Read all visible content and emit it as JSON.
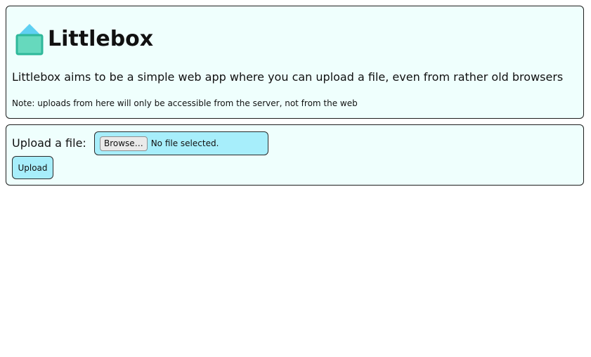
{
  "header": {
    "title": "Littlebox",
    "description": "Littlebox aims to be a simple web app where you can upload a file, even from rather old browsers",
    "note": "Note: uploads from here will only be accessible from the server, not from the web",
    "logo_icon": "box-icon",
    "logo_colors": {
      "roof": "#5fd0f2",
      "body": "#66d9bd",
      "outline": "#2fb89a"
    }
  },
  "upload": {
    "label": "Upload a file:",
    "browse_label": "Browse…",
    "file_status": "No file selected.",
    "submit_label": "Upload"
  },
  "colors": {
    "panel_background": "#effffd",
    "input_background": "#a7eefb",
    "border": "#1e1e1e"
  }
}
